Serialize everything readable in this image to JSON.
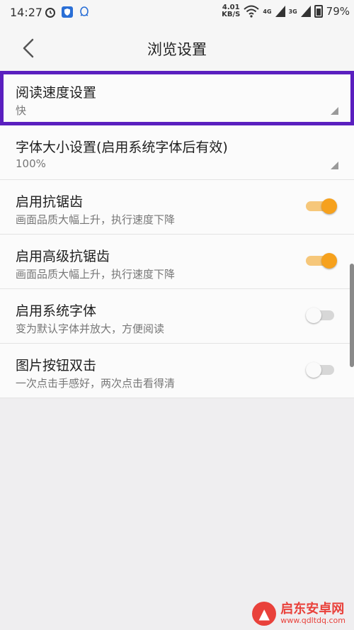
{
  "status_bar": {
    "time": "14:27",
    "net_speed_value": "4.01",
    "net_speed_unit": "KB/S",
    "signal1": "4G",
    "signal2": "3G",
    "battery": "79%"
  },
  "header": {
    "title": "浏览设置"
  },
  "settings": [
    {
      "label": "阅读速度设置",
      "value": "快",
      "type": "select",
      "selected": true
    },
    {
      "label": "字体大小设置(启用系统字体后有效)",
      "value": "100%",
      "type": "select"
    },
    {
      "label": "启用抗锯齿",
      "description": "画面品质大幅上升，执行速度下降",
      "type": "toggle",
      "on": true
    },
    {
      "label": "启用高级抗锯齿",
      "description": "画面品质大幅上升，执行速度下降",
      "type": "toggle",
      "on": true
    },
    {
      "label": "启用系统字体",
      "description": "变为默认字体并放大，方便阅读",
      "type": "toggle",
      "on": false
    },
    {
      "label": "图片按钮双击",
      "description": "一次点击手感好，两次点击看得清",
      "type": "toggle",
      "on": false
    }
  ],
  "watermark": {
    "name": "启东安卓网",
    "url": "www.qdltdq.com"
  },
  "colors": {
    "accent": "#f6a11d",
    "highlight": "#5a1fbf",
    "background": "#efeef0"
  }
}
